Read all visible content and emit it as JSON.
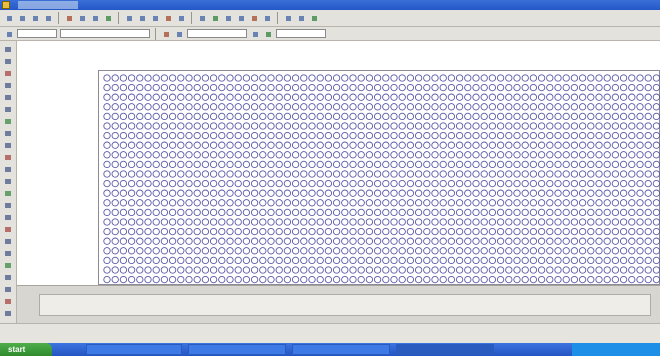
{
  "taskbar": {
    "start_label": "start"
  },
  "toolbars": {
    "standard": {
      "groups": [
        [
          "new-icon",
          "open-icon",
          "save-icon",
          "print-icon"
        ],
        [
          "cut-icon",
          "copy-icon",
          "paste-icon",
          "match-properties-icon"
        ],
        [
          "undo-icon",
          "redo-icon",
          "pan-icon",
          "zoom-icon"
        ],
        [
          "properties-icon",
          "design-center-icon",
          "tool-palettes-icon"
        ],
        [
          "help-icon"
        ]
      ]
    }
  },
  "drawing": {
    "pattern": "circle-array"
  }
}
